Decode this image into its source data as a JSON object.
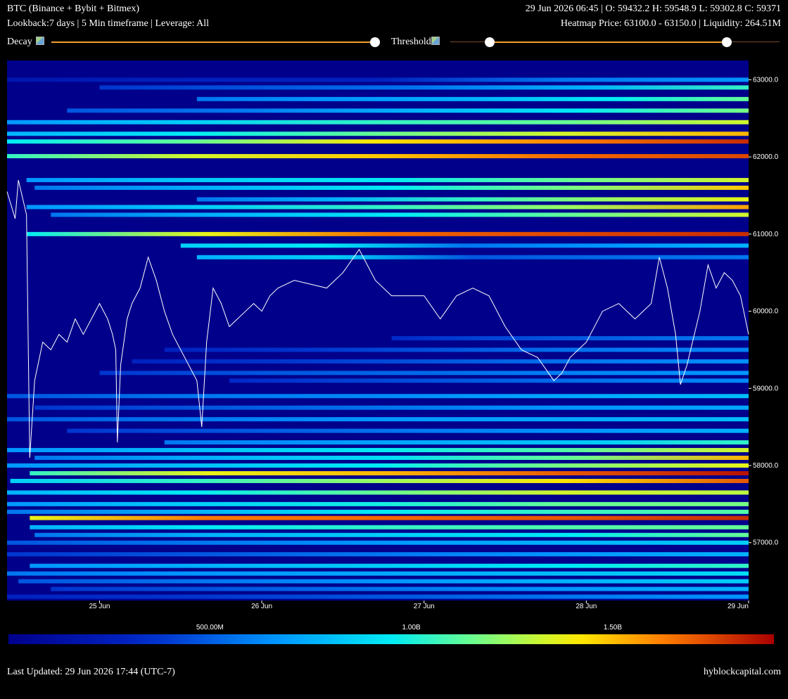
{
  "header": {
    "title": "BTC (Binance + Bybit + Bitmex)",
    "ohlc": "29 Jun 2026 06:45 | O: 59432.2 H: 59548.9 L: 59302.8 C: 59371",
    "settings": "Lookback:7 days | 5 Min timeframe | Leverage: All",
    "heatmap_info": "Heatmap Price: 63100.0 - 63150.0 | Liquidity: 264.51M"
  },
  "controls": {
    "decay_label": "Decay",
    "threshold_label": "Threshold",
    "decay_value": 1.0,
    "threshold_range": [
      0.12,
      0.84
    ],
    "accent_color": "#f0a030"
  },
  "footer": {
    "last_updated": "Last Updated: 29 Jun 2026 17:44 (UTC-7)",
    "site": "hyblockcapital.com"
  },
  "chart_data": {
    "type": "heatmap",
    "title": "",
    "x_unit": "days since 24 Jun 00:00",
    "xlim": [
      0.43,
      5.0
    ],
    "ylim": [
      56250,
      63250
    ],
    "x_ticks": [
      {
        "x": 1,
        "label": "25 Jun"
      },
      {
        "x": 2,
        "label": "26 Jun"
      },
      {
        "x": 3,
        "label": "27 Jun"
      },
      {
        "x": 4,
        "label": "28 Jun"
      },
      {
        "x": 5,
        "label": "29 Jun"
      }
    ],
    "y_ticks": [
      {
        "y": 57000,
        "label": "57000.0"
      },
      {
        "y": 58000,
        "label": "58000.0"
      },
      {
        "y": 59000,
        "label": "59000.0"
      },
      {
        "y": 60000,
        "label": "60000.0"
      },
      {
        "y": 61000,
        "label": "61000.0"
      },
      {
        "y": 62000,
        "label": "62000.0"
      },
      {
        "y": 63000,
        "label": "63000.0"
      }
    ],
    "background_color": "#00008b",
    "colorbar": {
      "min": 0,
      "max": 1.9,
      "ticks": [
        {
          "v": 0.5,
          "label": "500.00M"
        },
        {
          "v": 1.0,
          "label": "1.00B"
        },
        {
          "v": 1.5,
          "label": "1.50B"
        }
      ]
    },
    "liquidity_bands": [
      {
        "y": 63000,
        "x0": 0.43,
        "p": [
          0.1,
          0.15,
          0.15,
          0.3,
          0.35
        ]
      },
      {
        "y": 62900,
        "x0": 1.0,
        "p": [
          0.2,
          0.25,
          0.3,
          0.4,
          0.55
        ]
      },
      {
        "y": 62750,
        "x0": 1.6,
        "p": [
          0.3,
          0.35,
          0.4,
          0.5,
          0.6
        ]
      },
      {
        "y": 62600,
        "x0": 0.8,
        "p": [
          0.25,
          0.3,
          0.4,
          0.5,
          0.62
        ]
      },
      {
        "y": 62450,
        "x0": 0.43,
        "p": [
          0.35,
          0.45,
          0.55,
          0.6,
          0.7
        ]
      },
      {
        "y": 62300,
        "x0": 0.43,
        "p": [
          0.4,
          0.5,
          0.6,
          0.7,
          0.8
        ]
      },
      {
        "y": 62200,
        "x0": 0.43,
        "p": [
          0.5,
          0.6,
          0.75,
          0.85,
          0.95
        ]
      },
      {
        "y": 62010,
        "x0": 0.43,
        "p": [
          0.55,
          0.7,
          0.78,
          0.88,
          0.92
        ]
      },
      {
        "y": 61700,
        "x0": 0.55,
        "p": [
          0.35,
          0.45,
          0.5,
          0.6,
          0.7
        ]
      },
      {
        "y": 61600,
        "x0": 0.6,
        "p": [
          0.3,
          0.4,
          0.5,
          0.62,
          0.78
        ]
      },
      {
        "y": 61450,
        "x0": 1.6,
        "p": [
          0.3,
          0.4,
          0.55,
          0.65,
          0.72
        ]
      },
      {
        "y": 61350,
        "x0": 0.55,
        "p": [
          0.35,
          0.45,
          0.55,
          0.65,
          0.82
        ]
      },
      {
        "y": 61250,
        "x0": 0.7,
        "p": [
          0.3,
          0.4,
          0.5,
          0.6,
          0.7
        ]
      },
      {
        "y": 61000,
        "x0": 0.55,
        "p": [
          0.5,
          0.72,
          0.88,
          0.92,
          0.95
        ]
      },
      {
        "y": 60850,
        "x0": 1.5,
        "p": [
          0.45,
          0.5,
          0.3,
          0.35,
          0.4
        ]
      },
      {
        "y": 60700,
        "x0": 1.6,
        "p": [
          0.4,
          0.45,
          0.25,
          0.28,
          0.3
        ]
      },
      {
        "y": 59650,
        "x0": 2.8,
        "p": [
          0.18,
          0.22,
          0.25,
          0.28,
          0.3
        ]
      },
      {
        "y": 59500,
        "x0": 1.4,
        "p": [
          0.15,
          0.2,
          0.25,
          0.3,
          0.32
        ]
      },
      {
        "y": 59350,
        "x0": 1.2,
        "p": [
          0.15,
          0.2,
          0.25,
          0.3,
          0.34
        ]
      },
      {
        "y": 59200,
        "x0": 1.0,
        "p": [
          0.2,
          0.25,
          0.28,
          0.32,
          0.35
        ]
      },
      {
        "y": 59100,
        "x0": 1.8,
        "p": [
          0.18,
          0.22,
          0.26,
          0.3,
          0.33
        ]
      },
      {
        "y": 58900,
        "x0": 0.43,
        "p": [
          0.25,
          0.3,
          0.33,
          0.38,
          0.42
        ]
      },
      {
        "y": 58750,
        "x0": 0.6,
        "p": [
          0.2,
          0.25,
          0.3,
          0.35,
          0.38
        ]
      },
      {
        "y": 58600,
        "x0": 0.43,
        "p": [
          0.25,
          0.3,
          0.35,
          0.38,
          0.42
        ]
      },
      {
        "y": 58450,
        "x0": 0.8,
        "p": [
          0.2,
          0.25,
          0.3,
          0.35,
          0.4
        ]
      },
      {
        "y": 58300,
        "x0": 1.4,
        "p": [
          0.3,
          0.35,
          0.4,
          0.45,
          0.55
        ]
      },
      {
        "y": 58200,
        "x0": 0.43,
        "p": [
          0.35,
          0.42,
          0.5,
          0.58,
          0.7
        ]
      },
      {
        "y": 58100,
        "x0": 0.6,
        "p": [
          0.3,
          0.4,
          0.48,
          0.6,
          0.8
        ]
      },
      {
        "y": 58000,
        "x0": 0.43,
        "p": [
          0.35,
          0.42,
          0.5,
          0.62,
          0.72
        ]
      },
      {
        "y": 57900,
        "x0": 0.57,
        "p": [
          0.55,
          0.72,
          0.8,
          0.9,
          0.98
        ]
      },
      {
        "y": 57800,
        "x0": 0.45,
        "p": [
          0.45,
          0.55,
          0.65,
          0.75,
          0.9
        ]
      },
      {
        "y": 57650,
        "x0": 0.43,
        "p": [
          0.4,
          0.5,
          0.6,
          0.7,
          0.68
        ]
      },
      {
        "y": 57500,
        "x0": 0.43,
        "p": [
          0.35,
          0.45,
          0.52,
          0.6,
          0.62
        ]
      },
      {
        "y": 57400,
        "x0": 0.43,
        "p": [
          0.3,
          0.4,
          0.5,
          0.55,
          0.58
        ]
      },
      {
        "y": 57320,
        "x0": 0.57,
        "p": [
          0.72,
          0.86,
          0.88,
          0.9,
          0.95
        ]
      },
      {
        "y": 57200,
        "x0": 0.57,
        "p": [
          0.4,
          0.5,
          0.55,
          0.58,
          0.6
        ]
      },
      {
        "y": 57100,
        "x0": 0.6,
        "p": [
          0.3,
          0.4,
          0.45,
          0.5,
          0.6
        ]
      },
      {
        "y": 57000,
        "x0": 0.43,
        "p": [
          0.25,
          0.3,
          0.35,
          0.4,
          0.45
        ]
      },
      {
        "y": 56850,
        "x0": 0.43,
        "p": [
          0.2,
          0.25,
          0.3,
          0.35,
          0.4
        ]
      },
      {
        "y": 56700,
        "x0": 0.57,
        "p": [
          0.35,
          0.4,
          0.45,
          0.5,
          0.55
        ]
      },
      {
        "y": 56600,
        "x0": 0.43,
        "p": [
          0.3,
          0.35,
          0.38,
          0.42,
          0.48
        ]
      },
      {
        "y": 56500,
        "x0": 0.5,
        "p": [
          0.25,
          0.3,
          0.35,
          0.4,
          0.45
        ]
      },
      {
        "y": 56400,
        "x0": 0.7,
        "p": [
          0.2,
          0.25,
          0.3,
          0.35,
          0.4
        ]
      },
      {
        "y": 56300,
        "x0": 0.43,
        "p": [
          0.15,
          0.2,
          0.25,
          0.3,
          0.35
        ]
      }
    ],
    "price_series": {
      "name": "",
      "color": "#ffffff",
      "points": [
        [
          0.43,
          61550
        ],
        [
          0.48,
          61200
        ],
        [
          0.5,
          61700
        ],
        [
          0.55,
          61250
        ],
        [
          0.57,
          58100
        ],
        [
          0.6,
          59100
        ],
        [
          0.65,
          59600
        ],
        [
          0.7,
          59500
        ],
        [
          0.75,
          59700
        ],
        [
          0.8,
          59600
        ],
        [
          0.85,
          59900
        ],
        [
          0.9,
          59700
        ],
        [
          0.95,
          59900
        ],
        [
          1.0,
          60100
        ],
        [
          1.05,
          59900
        ],
        [
          1.08,
          59700
        ],
        [
          1.1,
          59500
        ],
        [
          1.11,
          58300
        ],
        [
          1.13,
          59300
        ],
        [
          1.17,
          59900
        ],
        [
          1.2,
          60100
        ],
        [
          1.25,
          60300
        ],
        [
          1.3,
          60700
        ],
        [
          1.35,
          60400
        ],
        [
          1.4,
          60000
        ],
        [
          1.45,
          59700
        ],
        [
          1.5,
          59500
        ],
        [
          1.55,
          59300
        ],
        [
          1.6,
          59100
        ],
        [
          1.63,
          58500
        ],
        [
          1.66,
          59600
        ],
        [
          1.7,
          60300
        ],
        [
          1.75,
          60100
        ],
        [
          1.8,
          59800
        ],
        [
          1.85,
          59900
        ],
        [
          1.9,
          60000
        ],
        [
          1.95,
          60100
        ],
        [
          2.0,
          60000
        ],
        [
          2.05,
          60200
        ],
        [
          2.1,
          60300
        ],
        [
          2.2,
          60400
        ],
        [
          2.3,
          60350
        ],
        [
          2.4,
          60300
        ],
        [
          2.5,
          60500
        ],
        [
          2.6,
          60800
        ],
        [
          2.65,
          60600
        ],
        [
          2.7,
          60400
        ],
        [
          2.8,
          60200
        ],
        [
          2.9,
          60200
        ],
        [
          3.0,
          60200
        ],
        [
          3.1,
          59900
        ],
        [
          3.2,
          60200
        ],
        [
          3.3,
          60300
        ],
        [
          3.4,
          60200
        ],
        [
          3.5,
          59800
        ],
        [
          3.6,
          59500
        ],
        [
          3.7,
          59400
        ],
        [
          3.8,
          59100
        ],
        [
          3.85,
          59200
        ],
        [
          3.9,
          59400
        ],
        [
          4.0,
          59600
        ],
        [
          4.1,
          60000
        ],
        [
          4.2,
          60100
        ],
        [
          4.3,
          59900
        ],
        [
          4.4,
          60100
        ],
        [
          4.45,
          60700
        ],
        [
          4.5,
          60300
        ],
        [
          4.55,
          59700
        ],
        [
          4.58,
          59050
        ],
        [
          4.62,
          59300
        ],
        [
          4.7,
          60000
        ],
        [
          4.75,
          60600
        ],
        [
          4.8,
          60300
        ],
        [
          4.85,
          60500
        ],
        [
          4.9,
          60400
        ],
        [
          4.95,
          60200
        ],
        [
          5.0,
          59700
        ]
      ]
    }
  }
}
